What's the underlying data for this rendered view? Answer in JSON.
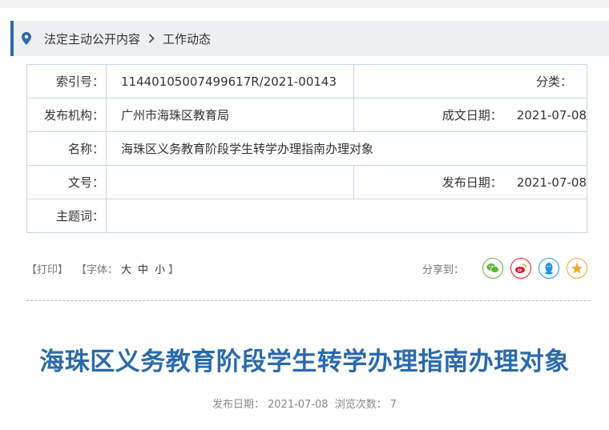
{
  "breadcrumb": {
    "items": [
      "法定主动公开内容",
      "工作动态"
    ]
  },
  "meta": {
    "index_label": "索引号：",
    "index_value": "11440105007499617R/2021-00143",
    "category_label": "分类：",
    "category_value": "",
    "publisher_label": "发布机构：",
    "publisher_value": "广州市海珠区教育局",
    "created_label": "成文日期：",
    "created_value": "2021-07-08",
    "name_label": "名称：",
    "name_value": "海珠区义务教育阶段学生转学办理指南办理对象",
    "docno_label": "文号：",
    "docno_value": "",
    "published_label": "发布日期：",
    "published_value": "2021-07-08",
    "subject_label": "主题词：",
    "subject_value": ""
  },
  "tools": {
    "print_label": "【打印】",
    "font_prefix": "【字体：",
    "font_large": "大",
    "font_medium": "中",
    "font_small": "小",
    "font_suffix": "】",
    "share_label": "分享到："
  },
  "share_icons": [
    "wechat-icon",
    "weibo-icon",
    "qq-icon",
    "qzone-icon"
  ],
  "colors": {
    "accent": "#2d6aa8",
    "title": "#2a6aac",
    "wechat": "#5cb531",
    "weibo": "#e6162d",
    "qq": "#1e96e0",
    "qzone": "#f5a623"
  },
  "article": {
    "title": "海珠区义务教育阶段学生转学办理指南办理对象",
    "pub_label": "发布日期：",
    "pub_date": "2021-07-08",
    "views_label": "浏览次数：",
    "views": "7"
  }
}
